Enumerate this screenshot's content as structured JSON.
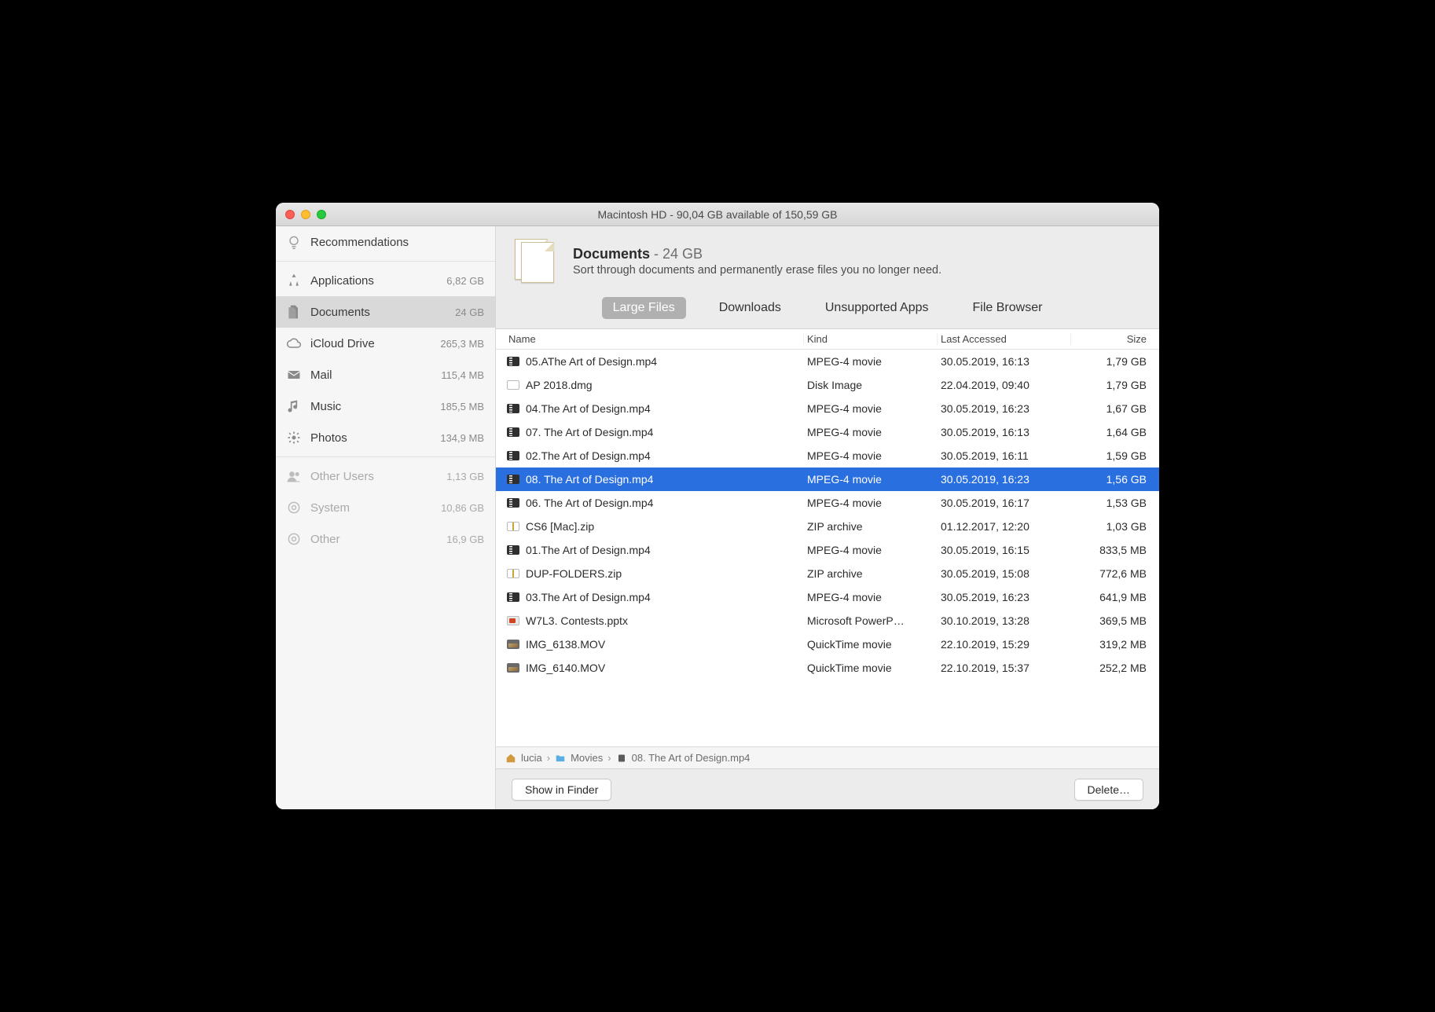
{
  "window_title": "Macintosh HD - 90,04 GB available of 150,59 GB",
  "sidebar": {
    "recommendations_label": "Recommendations",
    "items": [
      {
        "icon": "apps",
        "label": "Applications",
        "size": "6,82 GB"
      },
      {
        "icon": "docs",
        "label": "Documents",
        "size": "24 GB",
        "selected": true
      },
      {
        "icon": "cloud",
        "label": "iCloud Drive",
        "size": "265,3 MB"
      },
      {
        "icon": "mail",
        "label": "Mail",
        "size": "115,4 MB"
      },
      {
        "icon": "music",
        "label": "Music",
        "size": "185,5 MB"
      },
      {
        "icon": "photos",
        "label": "Photos",
        "size": "134,9 MB"
      }
    ],
    "disabled_items": [
      {
        "icon": "users",
        "label": "Other Users",
        "size": "1,13 GB"
      },
      {
        "icon": "system",
        "label": "System",
        "size": "10,86 GB"
      },
      {
        "icon": "other",
        "label": "Other",
        "size": "16,9 GB"
      }
    ]
  },
  "header": {
    "title": "Documents",
    "title_size": "24 GB",
    "description": "Sort through documents and permanently erase files you no longer need."
  },
  "tabs": [
    {
      "label": "Large Files",
      "active": true
    },
    {
      "label": "Downloads",
      "active": false
    },
    {
      "label": "Unsupported Apps",
      "active": false
    },
    {
      "label": "File Browser",
      "active": false
    }
  ],
  "columns": {
    "name": "Name",
    "kind": "Kind",
    "accessed": "Last Accessed",
    "size": "Size"
  },
  "files": [
    {
      "icon": "mov",
      "name": "05.AThe Art of Design.mp4",
      "kind": "MPEG-4 movie",
      "accessed": "30.05.2019, 16:13",
      "size": "1,79 GB"
    },
    {
      "icon": "dmg",
      "name": "AP 2018.dmg",
      "kind": "Disk Image",
      "accessed": "22.04.2019, 09:40",
      "size": "1,79 GB"
    },
    {
      "icon": "mov",
      "name": "04.The Art of Design.mp4",
      "kind": "MPEG-4 movie",
      "accessed": "30.05.2019, 16:23",
      "size": "1,67 GB"
    },
    {
      "icon": "mov",
      "name": "07. The Art of Design.mp4",
      "kind": "MPEG-4 movie",
      "accessed": "30.05.2019, 16:13",
      "size": "1,64 GB"
    },
    {
      "icon": "mov",
      "name": "02.The Art of Design.mp4",
      "kind": "MPEG-4 movie",
      "accessed": "30.05.2019, 16:11",
      "size": "1,59 GB"
    },
    {
      "icon": "mov",
      "name": "08. The Art of Design.mp4",
      "kind": "MPEG-4 movie",
      "accessed": "30.05.2019, 16:23",
      "size": "1,56 GB",
      "selected": true
    },
    {
      "icon": "mov",
      "name": "06. The Art of Design.mp4",
      "kind": "MPEG-4 movie",
      "accessed": "30.05.2019, 16:17",
      "size": "1,53 GB"
    },
    {
      "icon": "zip",
      "name": "CS6 [Mac].zip",
      "kind": "ZIP archive",
      "accessed": "01.12.2017, 12:20",
      "size": "1,03 GB"
    },
    {
      "icon": "mov",
      "name": "01.The Art of Design.mp4",
      "kind": "MPEG-4 movie",
      "accessed": "30.05.2019, 16:15",
      "size": "833,5 MB"
    },
    {
      "icon": "zip",
      "name": "DUP-FOLDERS.zip",
      "kind": "ZIP archive",
      "accessed": "30.05.2019, 15:08",
      "size": "772,6 MB"
    },
    {
      "icon": "mov",
      "name": "03.The Art of Design.mp4",
      "kind": "MPEG-4 movie",
      "accessed": "30.05.2019, 16:23",
      "size": "641,9 MB"
    },
    {
      "icon": "ppt",
      "name": "W7L3. Contests.pptx",
      "kind": "Microsoft PowerP…",
      "accessed": "30.10.2019, 13:28",
      "size": "369,5 MB"
    },
    {
      "icon": "img",
      "name": "IMG_6138.MOV",
      "kind": "QuickTime movie",
      "accessed": "22.10.2019, 15:29",
      "size": "319,2 MB"
    },
    {
      "icon": "img",
      "name": "IMG_6140.MOV",
      "kind": "QuickTime movie",
      "accessed": "22.10.2019, 15:37",
      "size": "252,2 MB"
    }
  ],
  "path": {
    "items": [
      {
        "icon": "home",
        "label": "lucia"
      },
      {
        "icon": "folder",
        "label": "Movies"
      },
      {
        "icon": "file",
        "label": "08. The Art of Design.mp4"
      }
    ]
  },
  "footer": {
    "show_in_finder": "Show in Finder",
    "delete": "Delete…"
  }
}
